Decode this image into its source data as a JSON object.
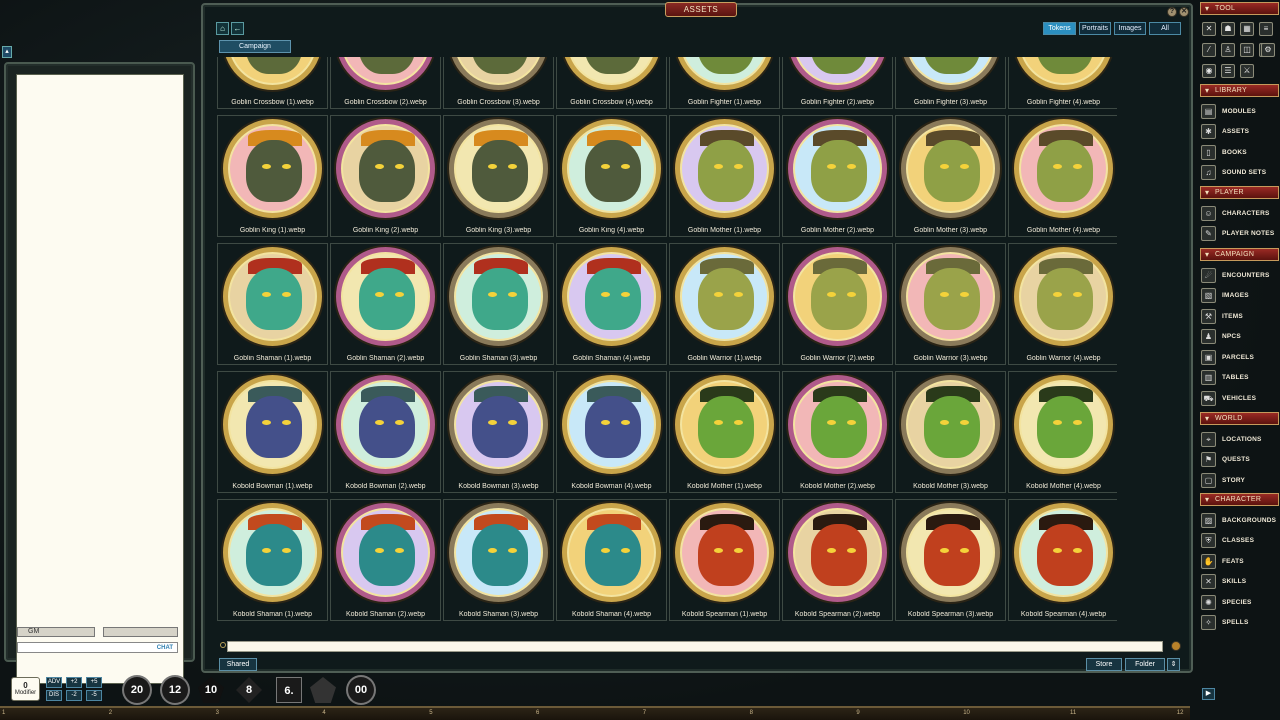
{
  "window": {
    "title": "ASSETS",
    "help": "?",
    "close": "✕"
  },
  "nav": {
    "home": "⌂",
    "back": "←"
  },
  "campaign_tab": "Campaign",
  "filters": [
    {
      "label": "Tokens",
      "active": true
    },
    {
      "label": "Portraits",
      "active": false
    },
    {
      "label": "Images",
      "active": false
    },
    {
      "label": "All",
      "active": false
    }
  ],
  "rows": [
    [
      "Goblin Crossbow (1).webp",
      "Goblin Crossbow (2).webp",
      "Goblin Crossbow (3).webp",
      "Goblin Crossbow (4).webp",
      "Goblin Fighter (1).webp",
      "Goblin Fighter (2).webp",
      "Goblin Fighter (3).webp",
      "Goblin Fighter (4).webp"
    ],
    [
      "Goblin King (1).webp",
      "Goblin King (2).webp",
      "Goblin King (3).webp",
      "Goblin King (4).webp",
      "Goblin Mother (1).webp",
      "Goblin Mother (2).webp",
      "Goblin Mother (3).webp",
      "Goblin Mother (4).webp"
    ],
    [
      "Goblin Shaman (1).webp",
      "Goblin Shaman (2).webp",
      "Goblin Shaman (3).webp",
      "Goblin Shaman (4).webp",
      "Goblin Warrior (1).webp",
      "Goblin Warrior (2).webp",
      "Goblin Warrior (3).webp",
      "Goblin Warrior (4).webp"
    ],
    [
      "Kobold Bowman (1).webp",
      "Kobold Bowman (2).webp",
      "Kobold Bowman (3).webp",
      "Kobold Bowman (4).webp",
      "Kobold Mother (1).webp",
      "Kobold Mother (2).webp",
      "Kobold Mother (3).webp",
      "Kobold Mother (4).webp"
    ],
    [
      "Kobold Shaman (1).webp",
      "Kobold Shaman (2).webp",
      "Kobold Shaman (3).webp",
      "Kobold Shaman (4).webp",
      "Kobold Spearman (1).webp",
      "Kobold Spearman (2).webp",
      "Kobold Spearman (3).webp",
      "Kobold Spearman (4).webp"
    ]
  ],
  "token_style": {
    "Goblin Crossbow": {
      "skin": "#5c6a3a",
      "crest": "#7a4a2a"
    },
    "Goblin Fighter": {
      "skin": "#6f8a3a",
      "crest": "#4a4a3a"
    },
    "Goblin King": {
      "skin": "#4f5a3c",
      "crest": "#d78a1e"
    },
    "Goblin Mother": {
      "skin": "#8fa046",
      "crest": "#5a4a2a"
    },
    "Goblin Shaman": {
      "skin": "#3fa88a",
      "crest": "#b0301e"
    },
    "Goblin Warrior": {
      "skin": "#9aa34a",
      "crest": "#6a6a3a"
    },
    "Kobold Bowman": {
      "skin": "#44508a",
      "crest": "#3a5a5a"
    },
    "Kobold Mother": {
      "skin": "#6aa63a",
      "crest": "#2a3a1a"
    },
    "Kobold Shaman": {
      "skin": "#2c8a8a",
      "crest": "#c24a1e"
    },
    "Kobold Spearman": {
      "skin": "#c0401e",
      "crest": "#2a1a10"
    }
  },
  "bg_variants": [
    "#f2d27a",
    "#f2b7b7",
    "#e8d3a2",
    "#f2e7b0",
    "#cfeedd",
    "#d8c8f0",
    "#c8e8f8"
  ],
  "frame_variants": [
    "#c9a54a",
    "#b05a8a",
    "#8a7a5a",
    "#c9a54a"
  ],
  "footer": {
    "shared": "Shared",
    "store": "Store",
    "folder": "Folder"
  },
  "chat": {
    "identity": "GM",
    "mood": "",
    "send_label": "CHAT"
  },
  "sidebar": {
    "tool_label": "TOOL",
    "library": {
      "label": "LIBRARY",
      "items": [
        "MODULES",
        "ASSETS",
        "BOOKS",
        "SOUND SETS"
      ]
    },
    "player": {
      "label": "PLAYER",
      "items": [
        "CHARACTERS",
        "PLAYER NOTES"
      ]
    },
    "campaign": {
      "label": "CAMPAIGN",
      "items": [
        "ENCOUNTERS",
        "IMAGES",
        "ITEMS",
        "NPCS",
        "PARCELS",
        "TABLES",
        "VEHICLES"
      ]
    },
    "world": {
      "label": "WORLD",
      "items": [
        "LOCATIONS",
        "QUESTS",
        "STORY"
      ]
    },
    "character": {
      "label": "CHARACTER",
      "items": [
        "BACKGROUNDS",
        "CLASSES",
        "FEATS",
        "SKILLS",
        "SPECIES",
        "SPELLS"
      ]
    }
  },
  "modifier": {
    "value": "0",
    "label": "Modifier"
  },
  "mod_buttons": [
    "ADV",
    "DIS",
    "+2",
    "-2",
    "+5",
    "-5"
  ],
  "dice": [
    "20",
    "12",
    "10",
    "8",
    "6.",
    "",
    "00"
  ],
  "timeline_ticks": [
    "1",
    "2",
    "3",
    "4",
    "5",
    "6",
    "7",
    "8",
    "9",
    "10",
    "11",
    "12"
  ]
}
